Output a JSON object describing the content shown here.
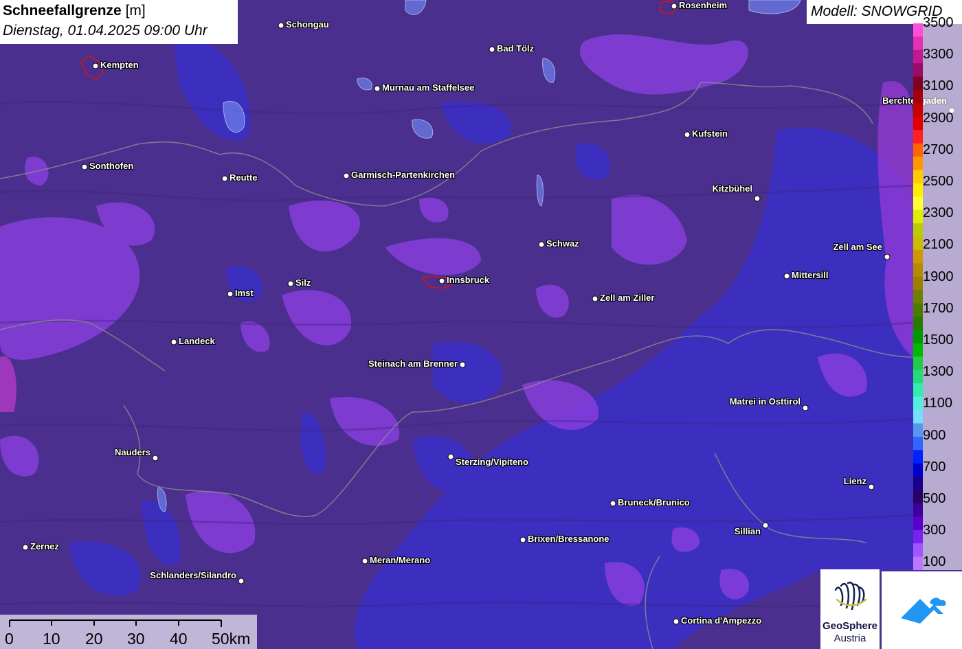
{
  "title": {
    "name": "Schneefallgrenze",
    "unit": "[m]",
    "datetime": "Dienstag, 01.04.2025 09:00 Uhr"
  },
  "model_label": "Modell: SNOWGRID",
  "legend": {
    "labels": [
      "3500",
      "3300",
      "3100",
      "2900",
      "2700",
      "2500",
      "2300",
      "2100",
      "1900",
      "1700",
      "1500",
      "1300",
      "1100",
      "900",
      "700",
      "500",
      "300",
      "100"
    ],
    "colors": [
      "#ff4fd8",
      "#e62fb2",
      "#c21a8c",
      "#9a0b66",
      "#800020",
      "#a00010",
      "#c80000",
      "#e00000",
      "#ff2020",
      "#ff6600",
      "#ff9900",
      "#ffcc00",
      "#ffee00",
      "#ffff33",
      "#ddee00",
      "#bbcc00",
      "#ccbb00",
      "#cc9900",
      "#b38a00",
      "#998000",
      "#6f7f00",
      "#4c7a00",
      "#2a7a00",
      "#009900",
      "#00bb00",
      "#22cc44",
      "#22dd77",
      "#33eeaa",
      "#55eedd",
      "#77ddff",
      "#5599ee",
      "#3366ff",
      "#0022ff",
      "#0000cc",
      "#1a0088",
      "#2a0066",
      "#3d0099",
      "#5a00cc",
      "#7a22ee",
      "#a055ff",
      "#bb77ff"
    ]
  },
  "cities": [
    {
      "name": "Rosenheim",
      "side": "r"
    },
    {
      "name": "Schongau",
      "side": "r"
    },
    {
      "name": "Kempten",
      "side": "r"
    },
    {
      "name": "Bad Tölz",
      "side": "r"
    },
    {
      "name": "Murnau am Staffelsee",
      "side": "r"
    },
    {
      "name": "Berchtesgaden",
      "side": "l"
    },
    {
      "name": "Kufstein",
      "side": "r"
    },
    {
      "name": "Sonthofen",
      "side": "r"
    },
    {
      "name": "Reutte",
      "side": "r"
    },
    {
      "name": "Garmisch-Partenkirchen",
      "side": "r"
    },
    {
      "name": "Kitzbühel",
      "side": "l"
    },
    {
      "name": "Schwaz",
      "side": "r"
    },
    {
      "name": "Zell am See",
      "side": "l"
    },
    {
      "name": "Innsbruck",
      "side": "r"
    },
    {
      "name": "Silz",
      "side": "r"
    },
    {
      "name": "Imst",
      "side": "r"
    },
    {
      "name": "Mittersill",
      "side": "r"
    },
    {
      "name": "Zell am Ziller",
      "side": "r"
    },
    {
      "name": "Landeck",
      "side": "r"
    },
    {
      "name": "Steinach am Brenner",
      "side": "l"
    },
    {
      "name": "Matrei in Osttirol",
      "side": "l"
    },
    {
      "name": "Nauders",
      "side": "l"
    },
    {
      "name": "Sterzing/Vipiteno",
      "side": "r"
    },
    {
      "name": "Lienz",
      "side": "l"
    },
    {
      "name": "Bruneck/Brunico",
      "side": "r"
    },
    {
      "name": "Sillian",
      "side": "l"
    },
    {
      "name": "Zernez",
      "side": "r"
    },
    {
      "name": "Brixen/Bressanone",
      "side": "r"
    },
    {
      "name": "Meran/Merano",
      "side": "r"
    },
    {
      "name": "Schlanders/Silandro",
      "side": "l"
    },
    {
      "name": "Cortina d'Ampezzo",
      "side": "r"
    }
  ],
  "scale": {
    "labels": [
      "0",
      "10",
      "20",
      "30",
      "40",
      "50km"
    ]
  },
  "logos": {
    "geosphere_line1": "GeoSphere",
    "geosphere_line2": "Austria"
  }
}
